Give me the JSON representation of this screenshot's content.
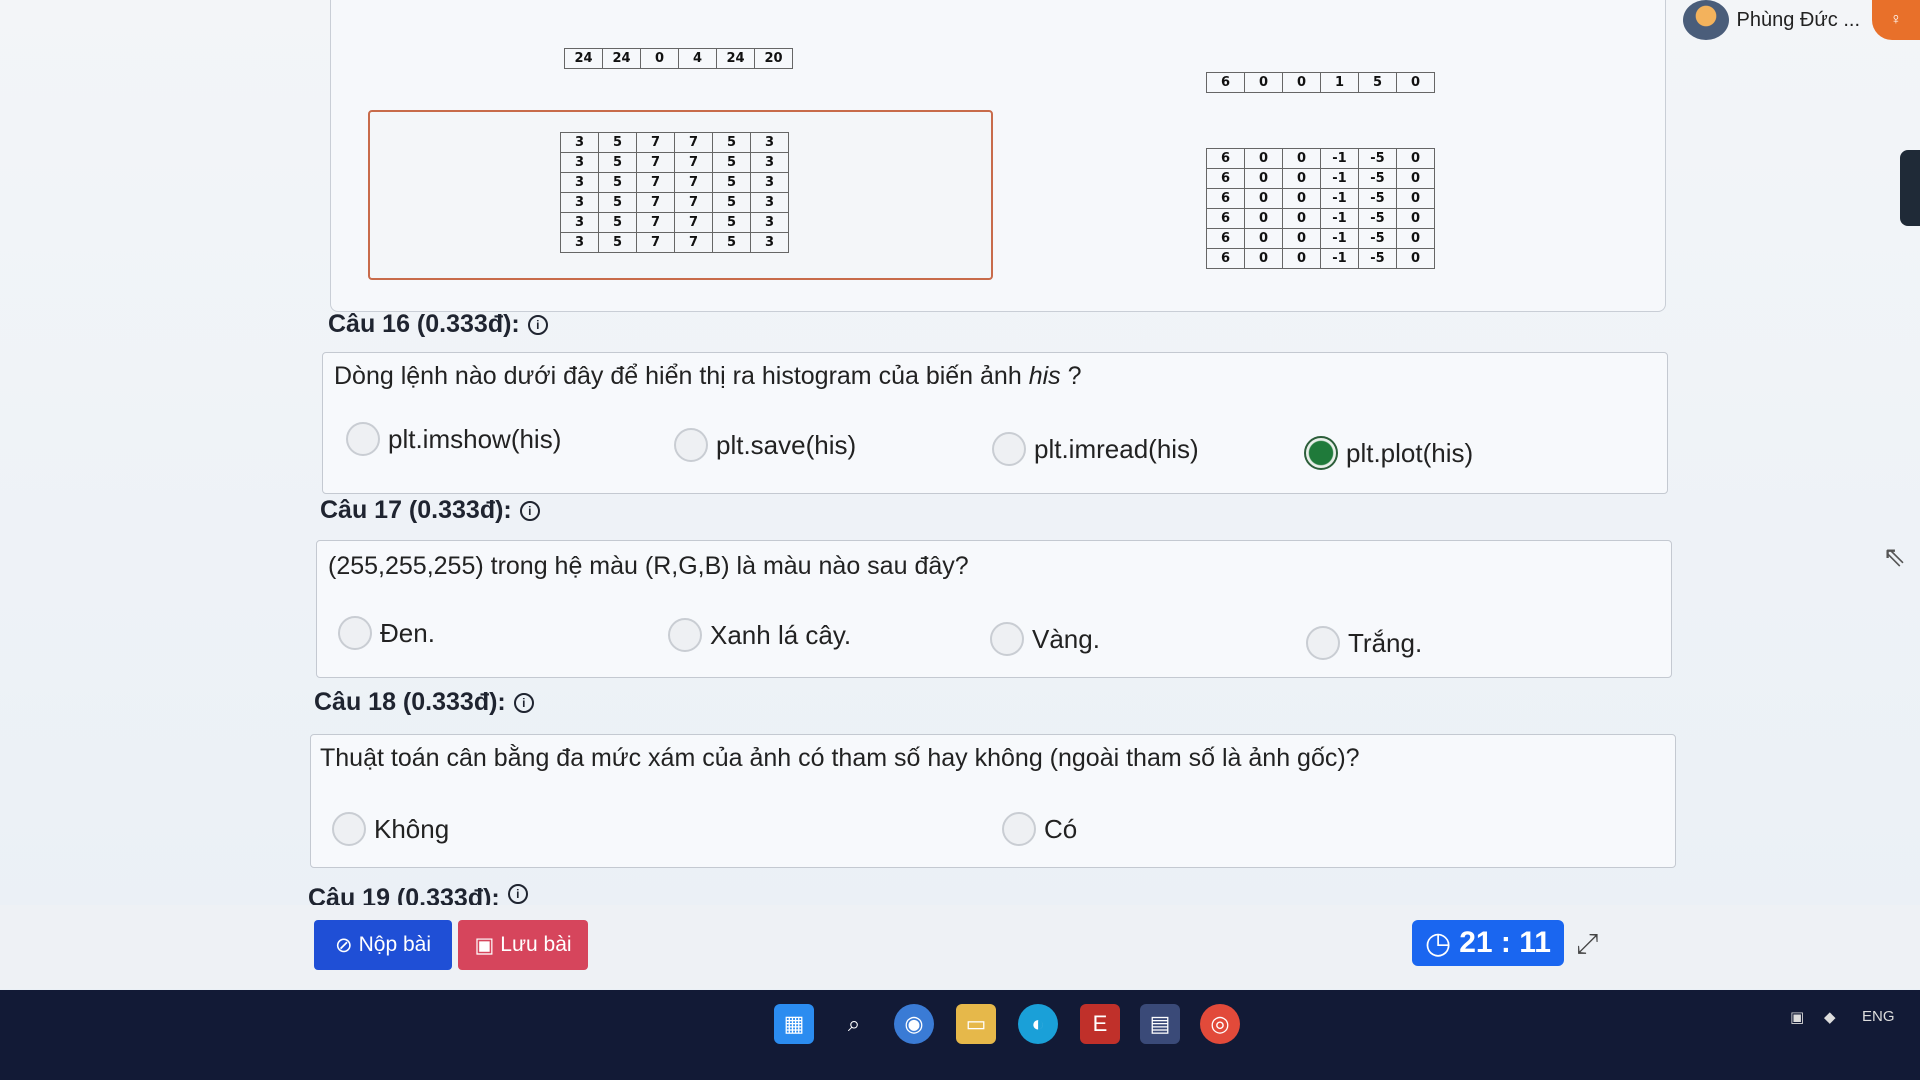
{
  "user": {
    "name": "Phùng Đức ..."
  },
  "top_tables": {
    "row_a": [
      "24",
      "24",
      "0",
      "4",
      "24",
      "20"
    ],
    "row_b": [
      "6",
      "0",
      "0",
      "1",
      "5",
      "0"
    ],
    "table_left": [
      [
        "3",
        "5",
        "7",
        "7",
        "5",
        "3"
      ],
      [
        "3",
        "5",
        "7",
        "7",
        "5",
        "3"
      ],
      [
        "3",
        "5",
        "7",
        "7",
        "5",
        "3"
      ],
      [
        "3",
        "5",
        "7",
        "7",
        "5",
        "3"
      ],
      [
        "3",
        "5",
        "7",
        "7",
        "5",
        "3"
      ],
      [
        "3",
        "5",
        "7",
        "7",
        "5",
        "3"
      ]
    ],
    "table_right": [
      [
        "6",
        "0",
        "0",
        "-1",
        "-5",
        "0"
      ],
      [
        "6",
        "0",
        "0",
        "-1",
        "-5",
        "0"
      ],
      [
        "6",
        "0",
        "0",
        "-1",
        "-5",
        "0"
      ],
      [
        "6",
        "0",
        "0",
        "-1",
        "-5",
        "0"
      ],
      [
        "6",
        "0",
        "0",
        "-1",
        "-5",
        "0"
      ],
      [
        "6",
        "0",
        "0",
        "-1",
        "-5",
        "0"
      ]
    ]
  },
  "questions": [
    {
      "title": "Câu 16 (0.333đ):",
      "text_before": "Dòng lệnh nào dưới đây để hiển thị ra histogram của biến ảnh ",
      "text_italic": "his",
      "text_after": " ?",
      "options": [
        "plt.imshow(his)",
        "plt.save(his)",
        "plt.imread(his)",
        "plt.plot(his)"
      ],
      "selected": "plt.plot(his)"
    },
    {
      "title": "Câu 17 (0.333đ):",
      "text": "(255,255,255) trong hệ màu (R,G,B) là màu nào sau đây?",
      "options": [
        "Đen.",
        "Xanh lá cây.",
        "Vàng.",
        "Trắng."
      ]
    },
    {
      "title": "Câu 18 (0.333đ):",
      "text": "Thuật toán cân bằng đa mức xám của ảnh có tham số hay không (ngoài tham số là ảnh gốc)?",
      "options": [
        "Không",
        "Có"
      ]
    },
    {
      "title": "Câu 19 (0.333đ):"
    }
  ],
  "actions": {
    "submit_label": "Nộp bài",
    "save_label": "Lưu bài"
  },
  "timer": "21 : 11",
  "tray": {
    "lang": "ENG"
  },
  "colors": {
    "submit": "#1f4fd6",
    "save": "#d6455c",
    "timer": "#1a66f0",
    "taskbar": "#121a36"
  }
}
